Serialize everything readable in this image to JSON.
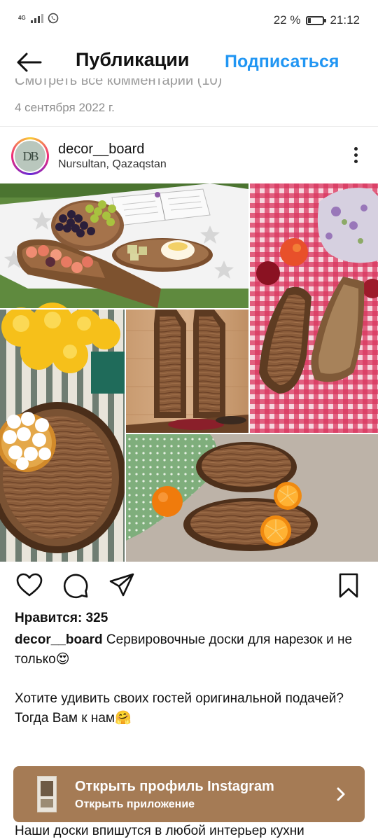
{
  "status_bar": {
    "network": "4G",
    "battery_percent": "22 %",
    "battery_level": 0.22,
    "time": "21:12",
    "icons": [
      "signal-icon",
      "whatsapp-icon",
      "battery-icon"
    ]
  },
  "header": {
    "title": "Публикации",
    "subscribe_label": "Подписаться",
    "back_icon": "arrow-left-icon"
  },
  "cut_off_line": "Смотреть все комментарии (10)",
  "post_date": "4 сентября 2022 г.",
  "author": {
    "avatar_text": "DB",
    "username": "decor__board",
    "location": "Nursultan, Qazaqstan"
  },
  "actions": {
    "icons": [
      "heart-icon",
      "comment-icon",
      "share-icon",
      "bookmark-icon"
    ]
  },
  "likes": "Нравится: 325",
  "caption": {
    "username": "decor__board",
    "line1": " Сервировочные доски для нарезок и не только😍",
    "line2": "Хотите удивить своих гостей оригинальной подачей?",
    "line3": "Тогда Вам к нам🤗",
    "tail": "Наши доски впишутся в любой интерьер кухни"
  },
  "banner": {
    "title": "Открыть профиль Instagram",
    "subtitle": "Открыть приложение",
    "color": "#a57b55"
  },
  "colors": {
    "accent": "#2196f3",
    "text": "#111111",
    "muted": "#8e8e8e"
  }
}
